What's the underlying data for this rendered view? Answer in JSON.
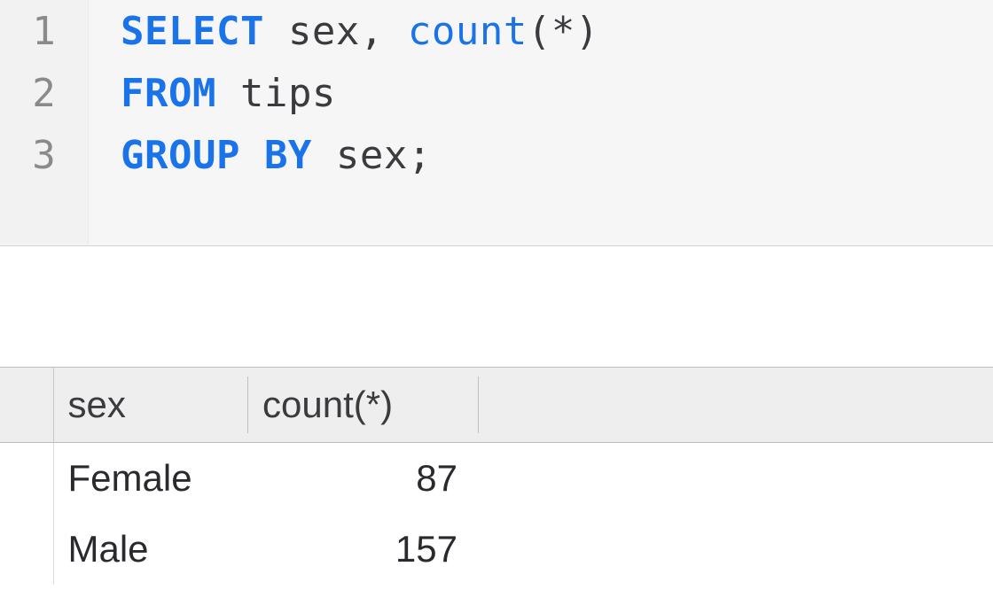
{
  "code": {
    "lines": [
      {
        "num": "1",
        "tokens": [
          {
            "t": "SELECT",
            "cls": "kw"
          },
          {
            "t": " sex, ",
            "cls": ""
          },
          {
            "t": "count",
            "cls": "fn"
          },
          {
            "t": "(*)",
            "cls": ""
          }
        ]
      },
      {
        "num": "2",
        "tokens": [
          {
            "t": "FROM",
            "cls": "kw"
          },
          {
            "t": " tips",
            "cls": ""
          }
        ]
      },
      {
        "num": "3",
        "tokens": [
          {
            "t": "GROUP BY",
            "cls": "kw"
          },
          {
            "t": " sex;",
            "cls": ""
          }
        ]
      }
    ]
  },
  "results": {
    "columns": [
      "sex",
      "count(*)"
    ],
    "rows": [
      {
        "sex": "Female",
        "count": 87
      },
      {
        "sex": "Male",
        "count": 157
      }
    ]
  }
}
